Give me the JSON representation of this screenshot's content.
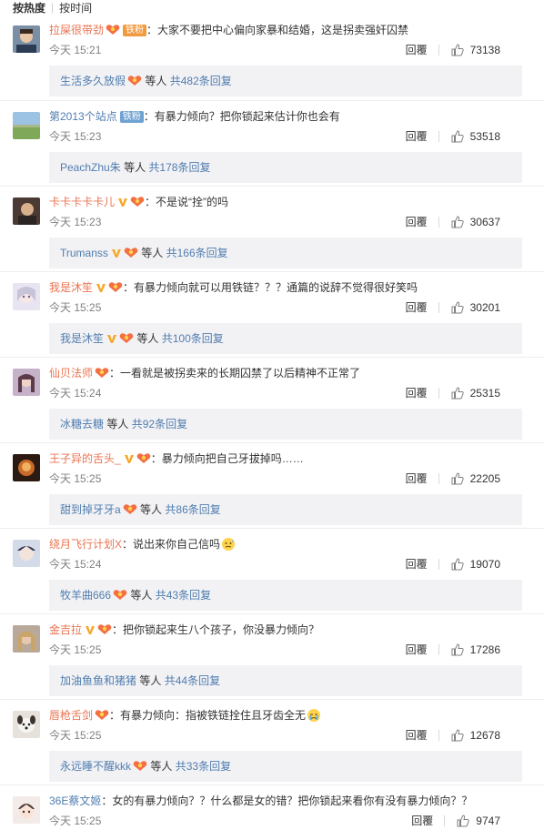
{
  "sort": {
    "hot": "按热度",
    "time": "按时间"
  },
  "reply_label": "回覆",
  "colors": {
    "author": "#eb7350",
    "link": "#507daf",
    "reply_bg": "#f2f2f5"
  },
  "comments": [
    {
      "author": "拉屎很带劲",
      "author_color": "orange",
      "badges": [
        "fan-badge",
        "tag:铁粉:orange"
      ],
      "text": "：大家不要把中心偏向家暴和结婚，这是拐卖强奸囚禁",
      "time": "今天 15:21",
      "likes": "73138",
      "reply_user": "生活多久放假",
      "reply_user_badges": [
        "fan-badge"
      ],
      "reply_etc": "等人",
      "reply_count": "共482条回复",
      "avatar": "portrait-man"
    },
    {
      "author": "第2013个站点",
      "author_color": "blue",
      "badges": [
        "tag:铁粉"
      ],
      "text": "：有暴力倾向？把你锁起来估计你也会有",
      "time": "今天 15:23",
      "likes": "53518",
      "reply_user": "PeachZhu朱",
      "reply_user_badges": [],
      "reply_etc": "等人",
      "reply_count": "共178条回复",
      "avatar": "landscape"
    },
    {
      "author": "卡卡卡卡卡儿",
      "author_color": "orange",
      "badges": [
        "v-badge",
        "fan-badge"
      ],
      "text": "：不是说“拴”的吗",
      "time": "今天 15:23",
      "likes": "30637",
      "reply_user": "Trumanss",
      "reply_user_badges": [
        "v-badge",
        "fan-badge"
      ],
      "reply_etc": "等人",
      "reply_count": "共166条回复",
      "avatar": "dark-portrait"
    },
    {
      "author": "我是沐笙",
      "author_color": "orange",
      "badges": [
        "v-badge",
        "fan-badge"
      ],
      "text": "：有暴力倾向就可以用铁链？？？通篇的说辞不觉得很好笑吗",
      "time": "今天 15:25",
      "likes": "30201",
      "reply_user": "我是沐笙",
      "reply_user_badges": [
        "v-badge",
        "fan-badge"
      ],
      "reply_etc": "等人",
      "reply_count": "共100条回复",
      "avatar": "anime-girl"
    },
    {
      "author": "仙贝法师",
      "author_color": "orange",
      "badges": [
        "fan-badge"
      ],
      "text": "：一看就是被拐卖来的长期囚禁了以后精神不正常了",
      "time": "今天 15:24",
      "likes": "25315",
      "reply_user": "冰糖去糖",
      "reply_user_badges": [],
      "reply_etc": "等人",
      "reply_count": "共92条回复",
      "avatar": "pink-portrait"
    },
    {
      "author": "王子异的舌头_",
      "author_color": "orange",
      "badges": [
        "v-badge",
        "fan-badge"
      ],
      "text": "：暴力倾向把自己牙拔掉吗……",
      "time": "今天 15:25",
      "likes": "22205",
      "reply_user": "甜到掉牙牙a",
      "reply_user_badges": [
        "fan-badge"
      ],
      "reply_etc": "等人",
      "reply_count": "共86条回复",
      "avatar": "fire-portrait"
    },
    {
      "author": "绕月飞行计划X",
      "author_color": "orange",
      "badges": [],
      "text": "：说出来你自己信吗",
      "emoji_after": "sweat-emoji",
      "time": "今天 15:24",
      "likes": "19070",
      "reply_user": "牧羊曲666",
      "reply_user_badges": [
        "fan-badge"
      ],
      "reply_etc": "等人",
      "reply_count": "共43条回复",
      "avatar": "anime-dark"
    },
    {
      "author": "金吉拉",
      "author_color": "orange",
      "badges": [
        "v-badge",
        "fan-badge"
      ],
      "text": "：把你锁起来生八个孩子，你没暴力倾向？",
      "time": "今天 15:25",
      "likes": "17286",
      "reply_user": "加油鱼鱼和猪猪",
      "reply_user_badges": [],
      "reply_etc": "等人",
      "reply_count": "共44条回复",
      "avatar": "blonde-portrait"
    },
    {
      "author": "唇枪舌剑",
      "author_color": "orange",
      "badges": [
        "fan-badge"
      ],
      "text": "：有暴力倾向：指被铁链拴住且牙齿全无",
      "emoji_after": "thumb-cry-emoji",
      "time": "今天 15:25",
      "likes": "12678",
      "reply_user": "永远睡不醒kkk",
      "reply_user_badges": [
        "fan-badge"
      ],
      "reply_etc": "等人",
      "reply_count": "共33条回复",
      "avatar": "dog"
    },
    {
      "author": "36E蔡文姬",
      "author_color": "blue",
      "badges": [],
      "text": "：女的有暴力倾向？？什么都是女的错？把你锁起来看你有没有暴力倾向？？",
      "time": "今天 15:25",
      "likes": "9747",
      "avatar": "cartoon-girl"
    }
  ]
}
